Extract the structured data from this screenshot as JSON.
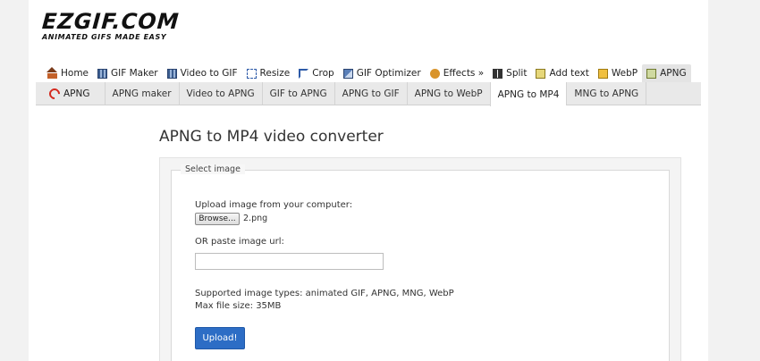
{
  "logo": {
    "main": "EZGIF.COM",
    "tagline": "ANIMATED GIFS MADE EASY"
  },
  "nav": {
    "items": [
      {
        "label": "Home",
        "icon": "home-icon"
      },
      {
        "label": "GIF Maker",
        "icon": "film-icon"
      },
      {
        "label": "Video to GIF",
        "icon": "video-icon"
      },
      {
        "label": "Resize",
        "icon": "resize-icon"
      },
      {
        "label": "Crop",
        "icon": "crop-icon"
      },
      {
        "label": "GIF Optimizer",
        "icon": "optimizer-icon"
      },
      {
        "label": "Effects »",
        "icon": "effects-icon"
      },
      {
        "label": "Split",
        "icon": "split-icon"
      },
      {
        "label": "Add text",
        "icon": "text-icon"
      },
      {
        "label": "WebP",
        "icon": "webp-icon"
      },
      {
        "label": "APNG",
        "icon": "apng-icon"
      }
    ],
    "active": "APNG"
  },
  "subnav": {
    "brand": "APNG",
    "items": [
      "APNG maker",
      "Video to APNG",
      "GIF to APNG",
      "APNG to GIF",
      "APNG to WebP",
      "APNG to MP4",
      "MNG to APNG"
    ],
    "active": "APNG to MP4"
  },
  "main": {
    "title": "APNG to MP4 video converter",
    "legend": "Select image",
    "upload_label": "Upload image from your computer:",
    "browse_label": "Browse...",
    "filename": "2.png",
    "url_label": "OR paste image url:",
    "url_value": "",
    "url_placeholder": "",
    "supported_types": "Supported image types: animated GIF, APNG, MNG, WebP",
    "max_size": "Max file size: 35MB",
    "upload_button": "Upload!"
  },
  "colors": {
    "accent_blue": "#2d6dc5",
    "apng_red": "#d42a1f",
    "subnav_bg": "#e9e9e9"
  }
}
